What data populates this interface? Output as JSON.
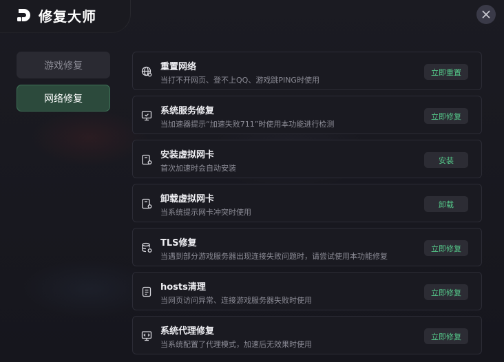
{
  "app": {
    "title": "修复大师"
  },
  "sidebar": {
    "items": [
      {
        "label": "游戏修复",
        "active": false
      },
      {
        "label": "网络修复",
        "active": true
      }
    ]
  },
  "rows": [
    {
      "icon": "globe-icon",
      "title": "重置网络",
      "desc": "当打不开网页、登不上QQ、游戏跳PING时使用",
      "button": "立即重置"
    },
    {
      "icon": "monitor-icon",
      "title": "系统服务修复",
      "desc": "当加速器提示“加速失败711”时使用本功能进行检测",
      "button": "立即修复"
    },
    {
      "icon": "network-card-icon",
      "title": "安装虚拟网卡",
      "desc": "首次加速时会自动安装",
      "button": "安装"
    },
    {
      "icon": "network-card-icon",
      "title": "卸载虚拟网卡",
      "desc": "当系统提示网卡冲突时使用",
      "button": "卸载"
    },
    {
      "icon": "database-gear-icon",
      "title": "TLS修复",
      "desc": "当遇到部分游戏服务器出现连接失败问题时，请尝试使用本功能修复",
      "button": "立即修复"
    },
    {
      "icon": "document-list-icon",
      "title": "hosts清理",
      "desc": "当网页访问异常、连接游戏服务器失败时使用",
      "button": "立即修复"
    },
    {
      "icon": "proxy-monitor-icon",
      "title": "系统代理修复",
      "desc": "当系统配置了代理模式，加速后无效果时使用",
      "button": "立即修复"
    }
  ],
  "colors": {
    "accent": "#55c98a",
    "active_tab_bg": "#2c4a3c",
    "row_bg": "#1a1a21",
    "background": "#15151c"
  }
}
